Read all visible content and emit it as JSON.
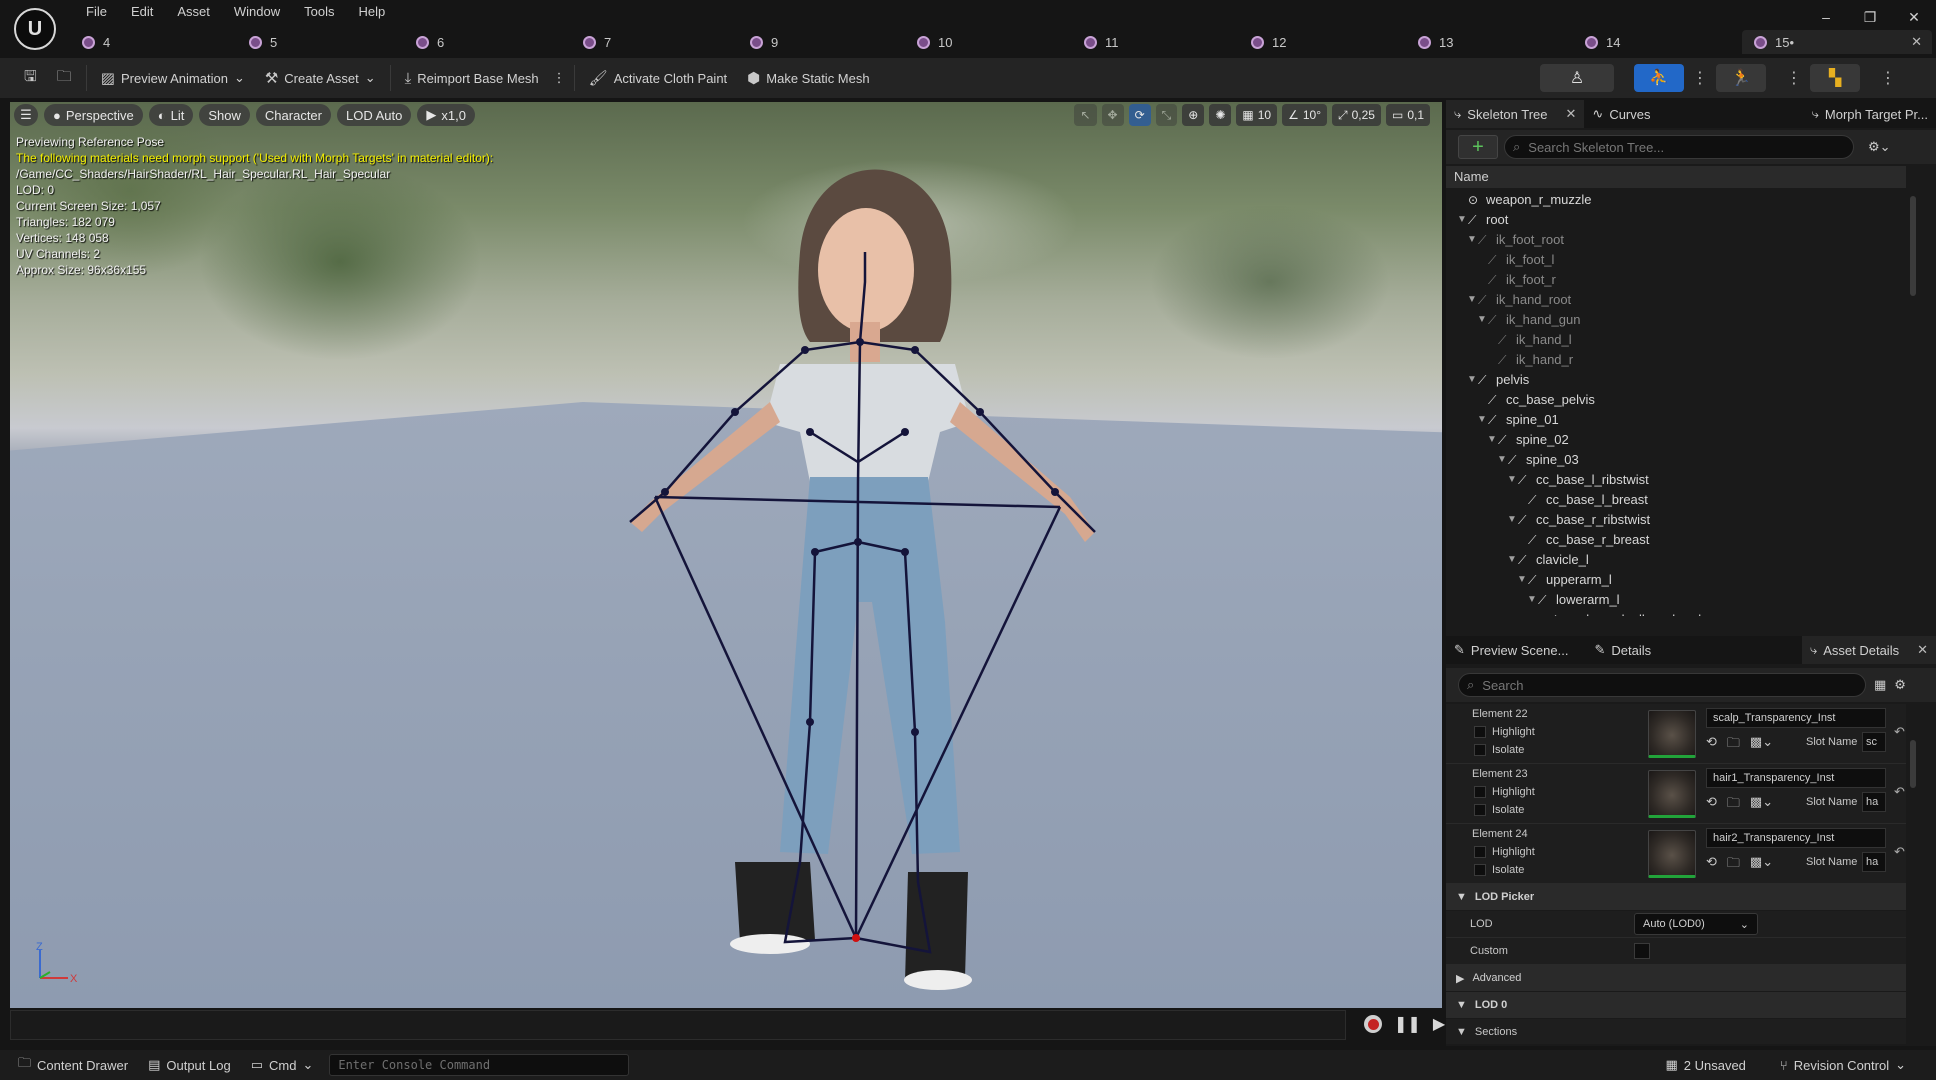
{
  "app": {
    "menu": [
      "File",
      "Edit",
      "Asset",
      "Window",
      "Tools",
      "Help"
    ],
    "tabs": [
      "4",
      "5",
      "6",
      "7",
      "9",
      "10",
      "11",
      "12",
      "13",
      "14"
    ],
    "active_tab": "15•"
  },
  "toolbar": {
    "preview_animation": "Preview Animation",
    "create_asset": "Create Asset",
    "reimport": "Reimport Base Mesh",
    "cloth_paint": "Activate Cloth Paint",
    "make_static": "Make Static Mesh"
  },
  "viewport": {
    "perspective": "Perspective",
    "lit": "Lit",
    "show": "Show",
    "character": "Character",
    "lod": "LOD Auto",
    "play_speed": "x1,0",
    "grid_size": "10",
    "angle_snap": "10°",
    "scale_snap": "0,25",
    "camera_speed": "0,1",
    "info": {
      "line1": "Previewing Reference Pose",
      "warning": "The following materials need morph support ('Used with Morph Targets' in material editor):",
      "path": "/Game/CC_Shaders/HairShader/RL_Hair_Specular.RL_Hair_Specular",
      "lod": "LOD: 0",
      "screen_size": "Current Screen Size: 1,057",
      "triangles": "Triangles: 182 079",
      "vertices": "Vertices: 148 058",
      "uv": "UV Channels: 2",
      "approx": "Approx Size: 96x36x155"
    },
    "axis_z": "Z",
    "axis_x": "X"
  },
  "statusbar": {
    "content_drawer": "Content Drawer",
    "output_log": "Output Log",
    "cmd": "Cmd",
    "console_placeholder": "Enter Console Command",
    "unsaved": "2 Unsaved",
    "revision": "Revision Control"
  },
  "skeleton": {
    "tab1": "Skeleton Tree",
    "tab2": "Curves",
    "tab3": "Morph Target Pr...",
    "search_placeholder": "Search Skeleton Tree...",
    "header": "Name",
    "rows": [
      {
        "label": "weapon_r_muzzle",
        "depth": 0,
        "arrow": "",
        "dim": false
      },
      {
        "label": "root",
        "depth": 0,
        "arrow": "▼",
        "dim": false
      },
      {
        "label": "ik_foot_root",
        "depth": 1,
        "arrow": "▼",
        "dim": true
      },
      {
        "label": "ik_foot_l",
        "depth": 2,
        "arrow": "",
        "dim": true
      },
      {
        "label": "ik_foot_r",
        "depth": 2,
        "arrow": "",
        "dim": true
      },
      {
        "label": "ik_hand_root",
        "depth": 1,
        "arrow": "▼",
        "dim": true
      },
      {
        "label": "ik_hand_gun",
        "depth": 2,
        "arrow": "▼",
        "dim": true
      },
      {
        "label": "ik_hand_l",
        "depth": 3,
        "arrow": "",
        "dim": true
      },
      {
        "label": "ik_hand_r",
        "depth": 3,
        "arrow": "",
        "dim": true
      },
      {
        "label": "pelvis",
        "depth": 1,
        "arrow": "▼",
        "dim": false
      },
      {
        "label": "cc_base_pelvis",
        "depth": 2,
        "arrow": "",
        "dim": false
      },
      {
        "label": "spine_01",
        "depth": 2,
        "arrow": "▼",
        "dim": false
      },
      {
        "label": "spine_02",
        "depth": 3,
        "arrow": "▼",
        "dim": false
      },
      {
        "label": "spine_03",
        "depth": 4,
        "arrow": "▼",
        "dim": false
      },
      {
        "label": "cc_base_l_ribstwist",
        "depth": 5,
        "arrow": "▼",
        "dim": false
      },
      {
        "label": "cc_base_l_breast",
        "depth": 6,
        "arrow": "",
        "dim": false
      },
      {
        "label": "cc_base_r_ribstwist",
        "depth": 5,
        "arrow": "▼",
        "dim": false
      },
      {
        "label": "cc_base_r_breast",
        "depth": 6,
        "arrow": "",
        "dim": false
      },
      {
        "label": "clavicle_l",
        "depth": 5,
        "arrow": "▼",
        "dim": false
      },
      {
        "label": "upperarm_l",
        "depth": 6,
        "arrow": "▼",
        "dim": false
      },
      {
        "label": "lowerarm_l",
        "depth": 7,
        "arrow": "▼",
        "dim": false
      },
      {
        "label": "cc_base_l_elbowsharebone",
        "depth": 8,
        "arrow": "",
        "dim": false
      }
    ]
  },
  "details": {
    "tab1": "Preview Scene...",
    "tab2": "Details",
    "tab3": "Asset Details",
    "search_placeholder": "Search",
    "elements": [
      {
        "name": "Element 22",
        "material": "scalp_Transparency_Inst",
        "slot": "sc"
      },
      {
        "name": "Element 23",
        "material": "hair1_Transparency_Inst",
        "slot": "ha"
      },
      {
        "name": "Element 24",
        "material": "hair2_Transparency_Inst",
        "slot": "ha"
      }
    ],
    "highlight": "Highlight",
    "isolate": "Isolate",
    "slot_label": "Slot Name",
    "lod_picker": "LOD Picker",
    "lod_label": "LOD",
    "lod_value": "Auto (LOD0)",
    "custom_label": "Custom",
    "advanced": "Advanced",
    "lod0": "LOD 0",
    "sections": "Sections"
  },
  "colors": {
    "accent_blue": "#2268c8",
    "warning": "#f4f000",
    "bone_line": "#14143a"
  }
}
